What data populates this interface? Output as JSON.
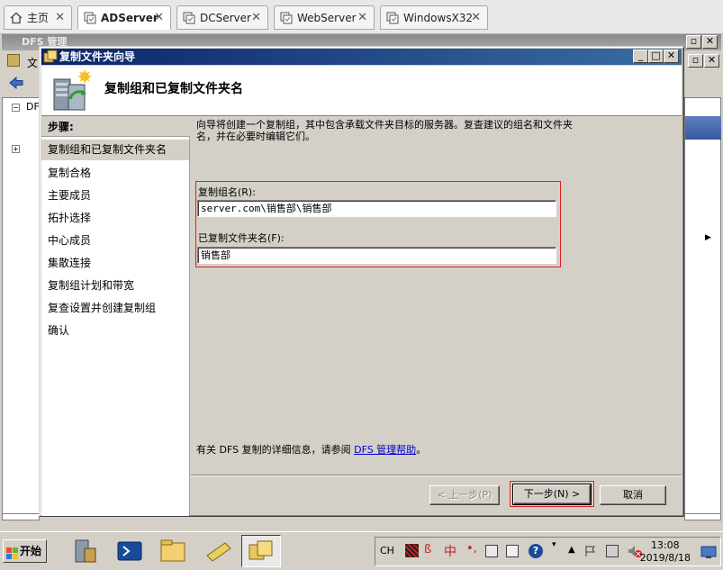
{
  "browser_tabs": [
    {
      "label": "主页",
      "icon": "home-icon"
    },
    {
      "label": "ADServer",
      "icon": "vm-icon",
      "active": true
    },
    {
      "label": "DCServer",
      "icon": "vm-icon"
    },
    {
      "label": "WebServer",
      "icon": "vm-icon"
    },
    {
      "label": "WindowsX32",
      "icon": "vm-icon"
    }
  ],
  "mmc": {
    "title": "DFS 管理",
    "menu_first": "文",
    "tree_root": "DF"
  },
  "wizard": {
    "title": "复制文件夹向导",
    "header_title": "复制组和已复制文件夹名",
    "steps_header": "步骤:",
    "steps": [
      "复制组和已复制文件夹名",
      "复制合格",
      "主要成员",
      "拓扑选择",
      "中心成员",
      "集散连接",
      "复制组计划和带宽",
      "复查设置并创建复制组",
      "确认"
    ],
    "active_step": 0,
    "description": "向导将创建一个复制组，其中包含承载文件夹目标的服务器。复查建议的组名和文件夹名，并在必要时编辑它们。",
    "group_label": "复制组名(R):",
    "group_value": "server.com\\销售部\\销售部",
    "folder_label": "已复制文件夹名(F):",
    "folder_value": "销售部",
    "help_prefix": "有关 DFS 复制的详细信息，请参阅",
    "help_link": "DFS 管理帮助",
    "help_suffix": "。",
    "back_button": "< 上一步(P)",
    "next_button": "下一步(N) >",
    "cancel_button": "取消",
    "highlight_color": "#e02020"
  },
  "taskbar": {
    "start_label": "开始",
    "lang": "CH",
    "ime_label": "中",
    "time": "13:08",
    "date": "2019/8/18"
  }
}
